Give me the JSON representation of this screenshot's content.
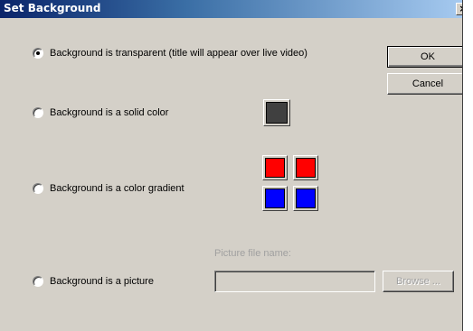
{
  "window": {
    "title": "Set Background",
    "close_glyph": "×"
  },
  "options": [
    {
      "label": "Background is transparent (title will appear over live video)",
      "checked": true
    },
    {
      "label": "Background is a solid color",
      "checked": false
    },
    {
      "label": "Background is a color gradient",
      "checked": false
    },
    {
      "label": "Background is a picture",
      "checked": false
    }
  ],
  "buttons": {
    "ok_label": "OK",
    "cancel_label": "Cancel",
    "browse_label": "Browse ..."
  },
  "solid_color": "#404040",
  "gradient_colors": [
    "#ff0000",
    "#ff0000",
    "#0000ff",
    "#0000ff"
  ],
  "picture": {
    "field_label": "Picture file name:",
    "file_name": ""
  }
}
